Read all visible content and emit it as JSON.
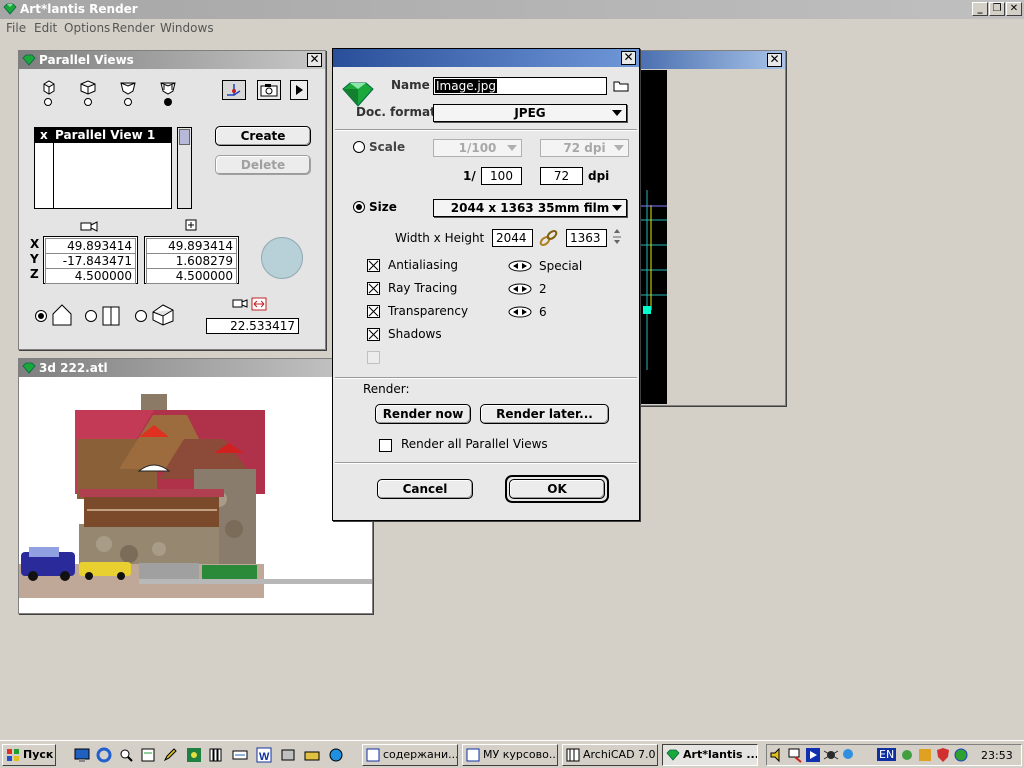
{
  "app": {
    "title": "Art*lantis Render",
    "menu": [
      "File",
      "Edit",
      "Options",
      "Render",
      "Windows"
    ],
    "controls": {
      "minimize": "_",
      "restore": "❐",
      "close": "✕"
    }
  },
  "parallel_views": {
    "title": "Parallel Views",
    "list_marker": "x",
    "list_items": [
      "Parallel View 1"
    ],
    "create_label": "Create",
    "delete_label": "Delete",
    "coord_labels": [
      "X",
      "Y",
      "Z"
    ],
    "camera_coords": [
      "49.893414",
      "-17.843471",
      "4.500000"
    ],
    "target_coords": [
      "49.893414",
      "1.608279",
      "4.500000"
    ],
    "distance": "22.533417"
  },
  "viewport": {
    "title": "3d 222.atl"
  },
  "render_dialog": {
    "name_label": "Name",
    "name_value": "Image.jpg",
    "format_label": "Doc. format",
    "format_value": "JPEG",
    "scale_label": "Scale",
    "scale_ratio": "1/100",
    "scale_dpi": "72 dpi",
    "scale_prefix": "1/",
    "scale_value": "100",
    "dpi_value": "72",
    "dpi_label": "dpi",
    "size_label": "Size",
    "size_value": "2044 x 1363  35mm film",
    "wh_label": "Width x Height",
    "width_value": "2044",
    "height_value": "1363",
    "options": [
      {
        "label": "Antialiasing",
        "value": "Special",
        "checked": true
      },
      {
        "label": "Ray Tracing",
        "value": "2",
        "checked": true
      },
      {
        "label": "Transparency",
        "value": "6",
        "checked": true
      },
      {
        "label": "Shadows",
        "value": "",
        "checked": true
      }
    ],
    "render_label": "Render:",
    "render_now_label": "Render now",
    "render_later_label": "Render later...",
    "render_all_label": "Render all Parallel Views",
    "cancel_label": "Cancel",
    "ok_label": "OK"
  },
  "taskbar": {
    "start_label": "Пуск",
    "tasks": [
      {
        "label": "содержани..."
      },
      {
        "label": "МУ курсово..."
      },
      {
        "label": "ArchiCAD 7.0"
      },
      {
        "label": "Art*lantis ..."
      }
    ],
    "language": "EN",
    "clock": "23:53"
  },
  "colors": {
    "accent": "#2a5fb0",
    "gem": "#1aa83a",
    "viewport_grid": "#24b8b8"
  }
}
